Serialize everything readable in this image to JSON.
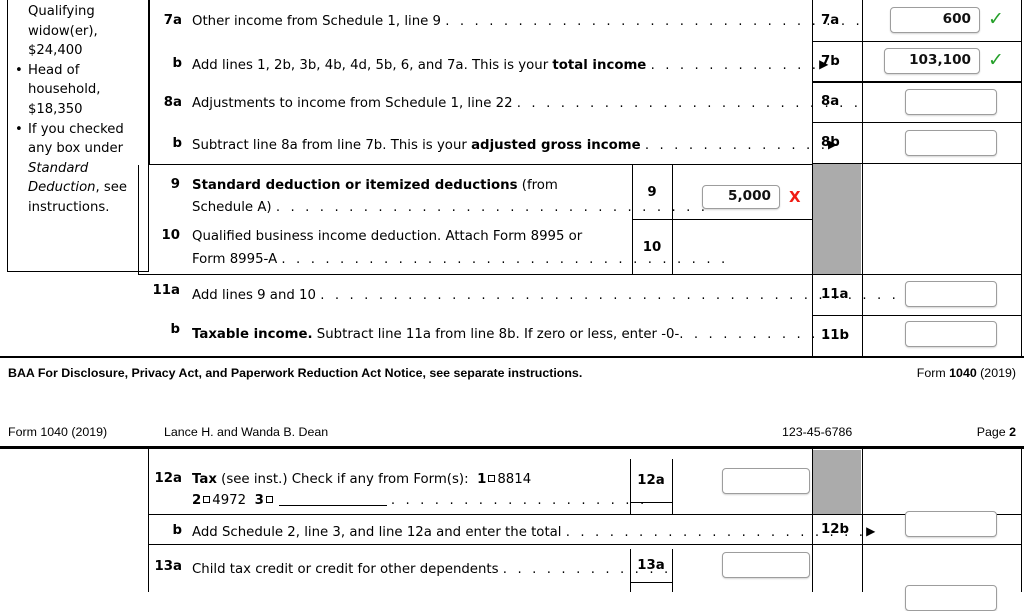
{
  "document": {
    "form_name": "Form 1040 (2019)",
    "taxpayer_name": "Lance H. and Wanda B. Dean",
    "ssn": "123-45-6786",
    "page_label": "Page",
    "page_number": "2"
  },
  "sidebar": {
    "items": [
      {
        "text": "Qualifying",
        "bullet": false
      },
      {
        "text": "widow(er),",
        "bullet": false
      },
      {
        "text": "$24,400",
        "bullet": false
      },
      {
        "text": "Head of",
        "bullet": true
      },
      {
        "text": "household,",
        "bullet": false
      },
      {
        "text": "$18,350",
        "bullet": false
      },
      {
        "text": "If you checked",
        "bullet": true
      },
      {
        "text": "any box under",
        "bullet": false
      },
      {
        "text": "Standard",
        "bullet": false,
        "italic": true
      },
      {
        "text": "Deduction, see",
        "bullet": false,
        "italic_partial": true
      },
      {
        "text": "instructions.",
        "bullet": false
      }
    ]
  },
  "page1": {
    "lines": [
      {
        "no": "7a",
        "text_before": "Other income from Schedule 1, line 9 ",
        "bold_part": "",
        "text_after": "",
        "dots": ". . . . . . . . . . . . . . . . . . . . . . . . . . . . .",
        "arrow": false,
        "cell_label": "7a",
        "value": "600",
        "status": "ok"
      },
      {
        "no": "b",
        "text_before": "Add lines 1, 2b, 3b, 4b, 4d, 5b, 6, and 7a. This is your ",
        "bold_part": "total income",
        "text_after": " ",
        "dots": ". . . . . . . . . . . .",
        "arrow": true,
        "cell_label": "7b",
        "value": "103,100",
        "status": "ok"
      },
      {
        "no": "8a",
        "text_before": "Adjustments to income from Schedule 1, line 22 ",
        "bold_part": "",
        "text_after": "",
        "dots": ". . . . . . . . . . . . . . . . . . . . . . . .",
        "arrow": false,
        "cell_label": "8a",
        "value": "",
        "status": ""
      },
      {
        "no": "b",
        "text_before": "Subtract line 8a from line 7b. This is your ",
        "bold_part": "adjusted gross income",
        "text_after": " ",
        "dots": ". . . . . . . . . . . . .",
        "arrow": true,
        "cell_label": "8b",
        "value": "",
        "status": ""
      }
    ],
    "line9": {
      "no": "9",
      "bold_part": "Standard deduction or itemized deductions",
      "text_after": " (from",
      "second_line": "Schedule A) ",
      "dots": ". . . . . . . . . . . . . . . . . . . . . . . . . . . . . .",
      "inner_label": "9",
      "value": "5,000",
      "status": "bad"
    },
    "line10": {
      "no": "10",
      "text_first": "Qualified business income deduction. Attach Form 8995 or",
      "text_second": "Form 8995-A ",
      "dots": ". . . . . . . . . . . . . . . . . . . . . . . . . . . . . . .",
      "inner_label": "10",
      "value": ""
    },
    "line11a": {
      "no": "11a",
      "text": "Add lines 9 and 10 ",
      "dots": ". . . . . . . . . . . . . . . . . . . . . . . . . . . . . . . . . . . . . . . . . .",
      "cell_label": "11a",
      "value": ""
    },
    "line11b": {
      "no": "b",
      "bold_part": "Taxable income.",
      "text_after": " Subtract line 11a from line 8b. If zero or less, enter -0-",
      "dots": ". . . . . . . . . . .",
      "cell_label": "11b",
      "value": ""
    }
  },
  "footer": {
    "notice": "BAA For Disclosure, Privacy Act, and Paperwork Reduction Act Notice, see separate instructions.",
    "form_prefix": "Form ",
    "form_number": "1040",
    "form_year": " (2019)"
  },
  "page2": {
    "line12a": {
      "no": "12a",
      "bold_part": "Tax",
      "text_after": " (see inst.) Check if any from Form(s):",
      "opt1_num": "1",
      "opt1_label": "8814",
      "opt2_num": "2",
      "opt2_label": "4972",
      "opt3_num": "3",
      "opt3_label": "",
      "dots": ". . . . . . . . . . . . . . . . . .",
      "inner_label": "12a",
      "value": ""
    },
    "line12b": {
      "no": "b",
      "text": "Add Schedule 2, line 3, and line 12a and enter the total ",
      "dots": ". . . . . . . . . . . . . . . . . . . . .",
      "arrow": true,
      "cell_label": "12b",
      "value": ""
    },
    "line13a": {
      "no": "13a",
      "text": "Child tax credit or credit for other dependents ",
      "dots": ". . . . . . . . . . . .",
      "inner_label": "13a",
      "value": ""
    }
  },
  "colors": {
    "ok": "#25a02a",
    "bad": "#f01c14",
    "gray_block": "#ababab",
    "input_border": "#9d9d9d"
  },
  "icons": {
    "ok": "✓",
    "bad": "X",
    "arrow": "▶",
    "bullet": "•"
  }
}
